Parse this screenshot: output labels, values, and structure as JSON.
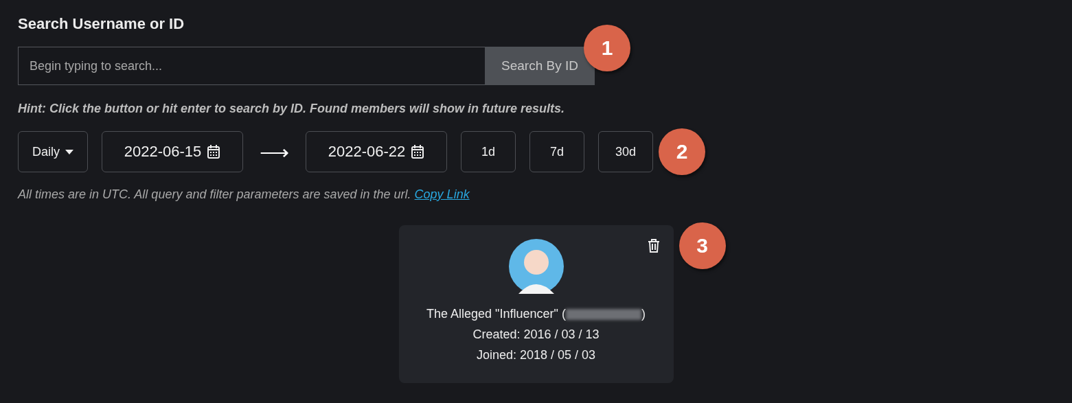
{
  "heading": "Search Username or ID",
  "search": {
    "placeholder": "Begin typing to search...",
    "button": "Search By ID"
  },
  "hint": "Hint: Click the button or hit enter to search by ID. Found members will show in future results.",
  "filters": {
    "interval": "Daily",
    "start_date": "2022-06-15",
    "arrow": "⟶",
    "end_date": "2022-06-22",
    "presets": [
      "1d",
      "7d",
      "30d"
    ]
  },
  "note": {
    "text": "All times are in UTC. All query and filter parameters are saved in the url.",
    "link": "Copy Link"
  },
  "member_card": {
    "name": "The Alleged \"Influencer\"",
    "handle_open": "(",
    "handle_close": ")",
    "created": "Created: 2016 / 03 / 13",
    "joined": "Joined: 2018 / 05 / 03"
  },
  "callouts": [
    "1",
    "2",
    "3"
  ]
}
